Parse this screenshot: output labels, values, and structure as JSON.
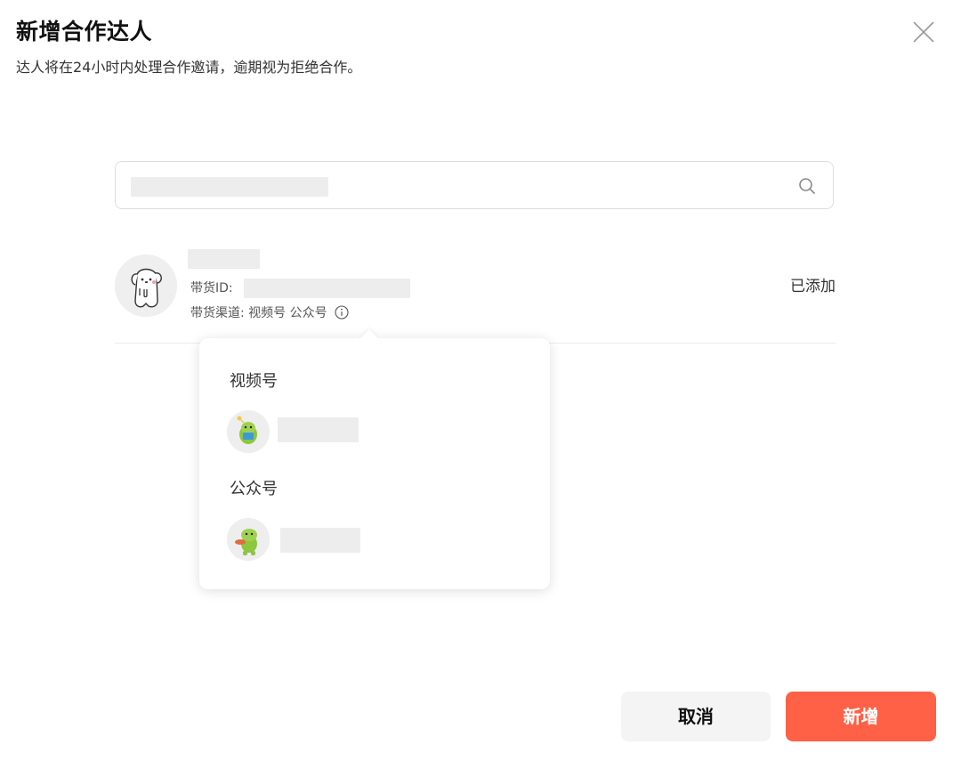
{
  "dialog": {
    "title": "新增合作达人",
    "subtitle": "达人将在24小时内处理合作邀请，逾期视为拒绝合作。",
    "close_icon": "close-icon"
  },
  "search": {
    "value": "",
    "placeholder": "",
    "icon": "search-icon"
  },
  "result": {
    "name": "",
    "id_label": "带货ID:",
    "id_value": "",
    "channels_label": "带货渠道:",
    "channels": [
      "视频号",
      "公众号"
    ],
    "status": "已添加",
    "info_icon": "info-icon"
  },
  "popover": {
    "sections": [
      {
        "title": "视频号",
        "account_name": ""
      },
      {
        "title": "公众号",
        "account_name": ""
      }
    ]
  },
  "footer": {
    "cancel_label": "取消",
    "confirm_label": "新增"
  },
  "colors": {
    "primary": "#fe6146",
    "cancel_bg": "#f4f4f4",
    "border": "#dedede",
    "mascot_green": "#8dc63f"
  }
}
